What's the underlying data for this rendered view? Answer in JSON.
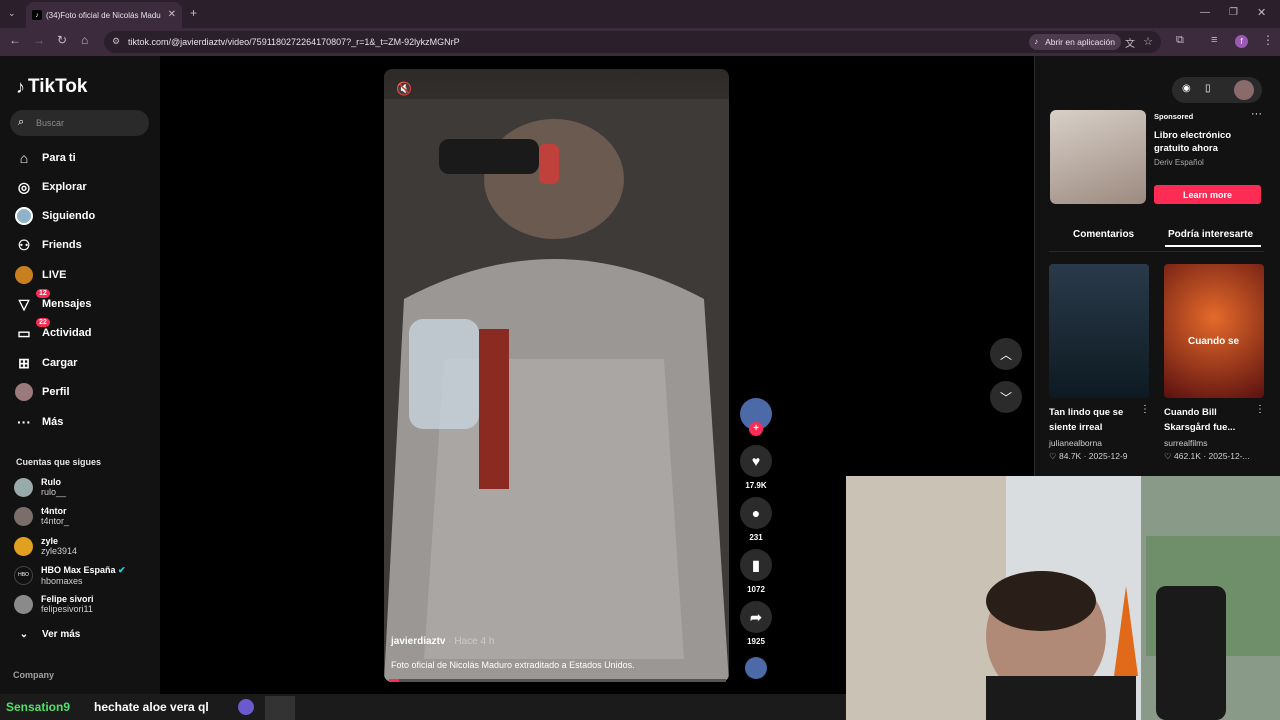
{
  "browser": {
    "tab_title": "(34)Foto oficial de Nicolás Madu",
    "url": "tiktok.com/@javierdiaztv/video/7591180272264170807?_r=1&_t=ZM-92lykzMGNrP",
    "open_app": "Abrir en aplicación"
  },
  "sidebar": {
    "logo": "TikTok",
    "search_placeholder": "Buscar",
    "items": [
      {
        "label": "Para ti",
        "icon": "home-icon"
      },
      {
        "label": "Explorar",
        "icon": "compass-icon"
      },
      {
        "label": "Siguiendo",
        "icon": "following-avatar-icon"
      },
      {
        "label": "Friends",
        "icon": "friends-icon"
      },
      {
        "label": "LIVE",
        "icon": "live-icon"
      },
      {
        "label": "Mensajes",
        "icon": "messages-icon",
        "badge": "12"
      },
      {
        "label": "Actividad",
        "icon": "activity-icon",
        "badge": "22"
      },
      {
        "label": "Cargar",
        "icon": "upload-icon"
      },
      {
        "label": "Perfil",
        "icon": "profile-icon"
      },
      {
        "label": "Más",
        "icon": "more-icon"
      }
    ],
    "following_title": "Cuentas que sigues",
    "following": [
      {
        "name": "Rulo",
        "user": "rulo__"
      },
      {
        "name": "t4ntor",
        "user": "t4ntor_"
      },
      {
        "name": "zyle",
        "user": "zyle3914"
      },
      {
        "name": "HBO Max España",
        "user": "hbomaxes"
      },
      {
        "name": "Felipe sivori",
        "user": "felipesivori11"
      }
    ],
    "see_more": "Ver más",
    "company": "Company"
  },
  "video": {
    "author": "javierdiaztv",
    "time": "· Hace 4 h",
    "description": "Foto oficial de Nicolás Maduro extraditado a Estados Unidos.",
    "progress": 0.03
  },
  "actions": {
    "likes": "17.9K",
    "comments": "231",
    "saves": "1072",
    "shares": "1925"
  },
  "right_panel": {
    "sponsored": "Sponsored",
    "ad_title": "Libro electrónico gratuito ahora",
    "ad_brand": "Deriv Español",
    "learn_more": "Learn more",
    "tab_comments": "Comentarios",
    "tab_interest": "Podría interesarte",
    "cards": [
      {
        "title": "Tan lindo que se siente irreal",
        "author": "julianealborna",
        "likes": "84.7K",
        "date": "2025-12-9"
      },
      {
        "title": "Cuando Bill Skarsgård fue...",
        "author": "surrealfilms",
        "likes": "462.1K",
        "date": "2025-12-...",
        "overlay": "Cuando se"
      }
    ]
  },
  "chat": {
    "name": "Sensation9",
    "message": "hechate aloe vera ql"
  }
}
